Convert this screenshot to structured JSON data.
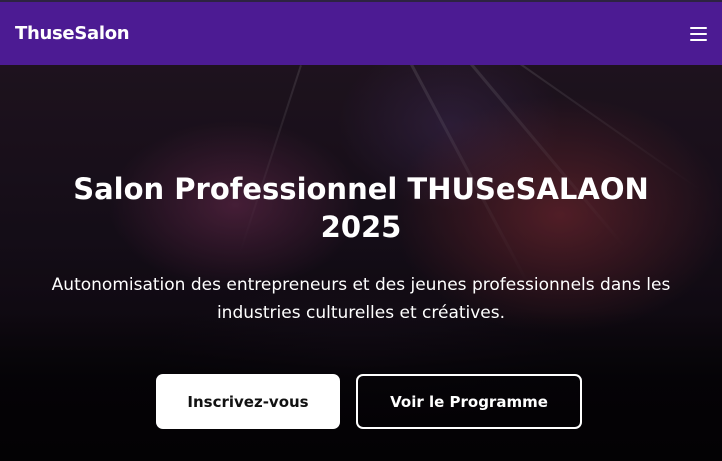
{
  "navbar": {
    "brand": "ThuseSalon",
    "menu_icon": "hamburger-menu-icon"
  },
  "hero": {
    "title": "Salon Professionnel THUSeSALAON 2025",
    "subtitle": "Autonomisation des entrepreneurs et des jeunes professionnels dans les industries culturelles et créatives.",
    "primary_button": "Inscrivez-vous",
    "secondary_button": "Voir le Programme"
  },
  "colors": {
    "navbar_bg": "#4c1b93",
    "text": "#ffffff",
    "primary_button_bg": "#ffffff",
    "primary_button_text": "#111111"
  }
}
